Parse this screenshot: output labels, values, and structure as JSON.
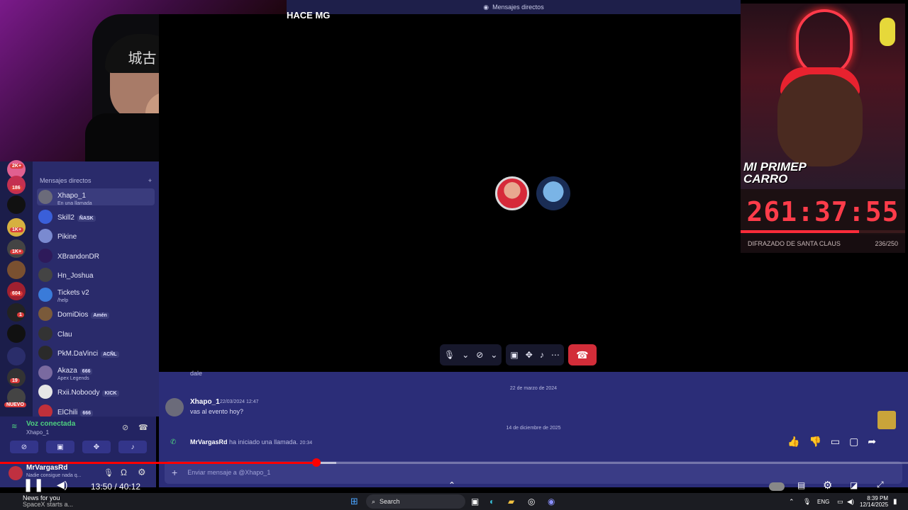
{
  "window": {
    "title": "Mensajes directos",
    "call_title": "HACE MG"
  },
  "stream": {
    "banner_line1": "MI PRIMEP",
    "banner_line2": "CARRO",
    "timer": "261:37:55",
    "goal_label": "DIFRAZADO DE SANTA CLAUS",
    "goal_count": "236/250",
    "goal_progress": 0.72
  },
  "webcam": {
    "cap_text": "城古"
  },
  "servers": {
    "badges": [
      "2K+",
      "186",
      "1K+",
      "1K+",
      "604",
      "1",
      "19",
      "NUEVO"
    ]
  },
  "dms": {
    "header": "Mensajes directos",
    "add": "+",
    "items": [
      {
        "name": "Xhapo_1",
        "sub": "En una llamada",
        "tag": "",
        "color": "#6b6b7a"
      },
      {
        "name": "Skill2",
        "sub": "",
        "tag": "ÑASK",
        "color": "#3a5fd9"
      },
      {
        "name": "Pikine",
        "sub": "",
        "tag": "",
        "color": "#7a8ad0"
      },
      {
        "name": "XBrandonDR",
        "sub": "",
        "tag": "",
        "color": "#2e1a5a"
      },
      {
        "name": "Hn_Joshua",
        "sub": "",
        "tag": "",
        "color": "#444"
      },
      {
        "name": "Tickets v2",
        "sub": "/help",
        "tag": "",
        "color": "#3a7bd9"
      },
      {
        "name": "DomiDios",
        "sub": "",
        "tag": "Amén",
        "color": "#7a5a3a"
      },
      {
        "name": "Clau",
        "sub": "",
        "tag": "",
        "color": "#333"
      },
      {
        "name": "PkM.DaVinci",
        "sub": "",
        "tag": "ACÑL",
        "color": "#2a2a2a"
      },
      {
        "name": "Akaza",
        "sub": "Apex Legends",
        "tag": "666",
        "color": "#7a6aa0"
      },
      {
        "name": "Rxii.Noboody",
        "sub": "",
        "tag": "KICK",
        "color": "#e6e6e6"
      },
      {
        "name": "ElChili",
        "sub": "",
        "tag": "666",
        "color": "#c0303a"
      }
    ]
  },
  "voice": {
    "status": "Voz conectada",
    "channel": "Xhapo_1"
  },
  "user": {
    "name": "MrVargasRd",
    "status": "Nadie consigue nada q..."
  },
  "chat": {
    "sep1": "22 de marzo de 2024",
    "msg_author": "Xhapo_1",
    "msg_time": "22/03/2024 12:47",
    "msg_text": "vas al evento hoy?",
    "prev_text": "dale",
    "sep2": "14 de diciembre de 2025",
    "call_user": "MrVargasRd",
    "call_text": "ha iniciado una llamada.",
    "call_time": "20:34",
    "placeholder": "Enviar mensaje a @Xhapo_1"
  },
  "player": {
    "time": "13:50 / 40:12",
    "progress": 0.344
  },
  "taskbar": {
    "news_title": "News for you",
    "news_sub": "SpaceX starts a...",
    "search": "Search",
    "lang": "ENG",
    "clock_time": "8:39 PM",
    "clock_date": "12/14/2025"
  },
  "colors": {
    "accent": "#5865f2",
    "hangup": "#d22d39",
    "online": "#4ed17f",
    "youtube_red": "#ff0000"
  }
}
